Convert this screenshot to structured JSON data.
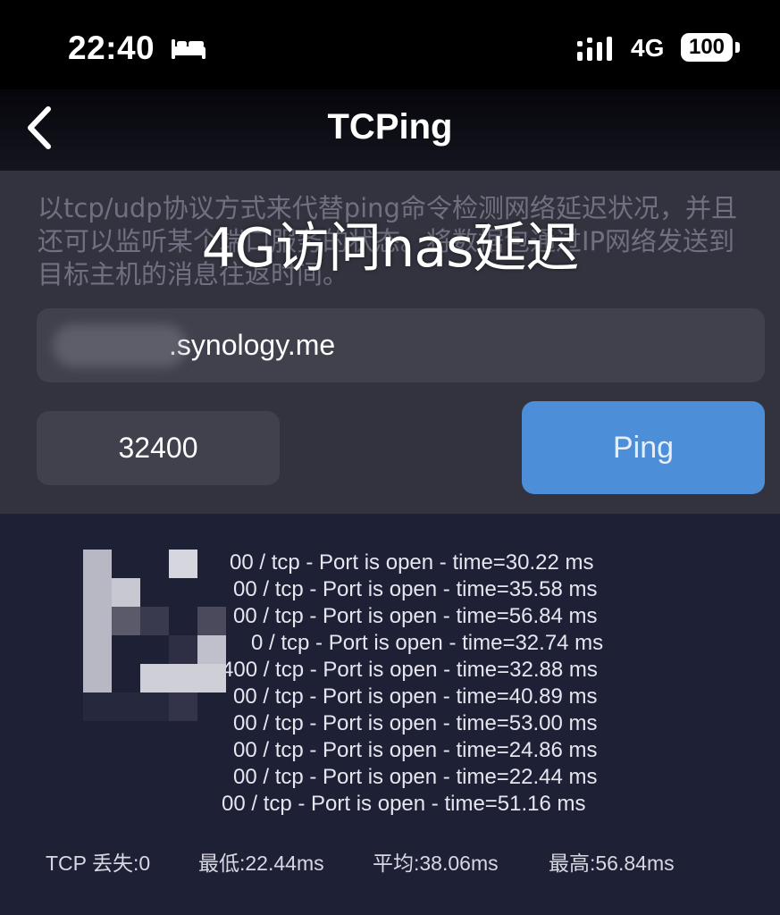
{
  "status_bar": {
    "time": "22:40",
    "focus_icon": "bed-icon",
    "signal_icon": "signal-icon",
    "network": "4G",
    "battery": "100"
  },
  "nav": {
    "back_icon": "chevron-left-icon",
    "title": "TCPing"
  },
  "description": "以tcp/udp协议方式来代替ping命令检测网络延迟状况，并且还可以监听某个端口服务的状态。将数据包通过IP网络发送到目标主机的消息往返时间。",
  "overlay_caption": "4G访问nas延迟",
  "host_input": {
    "value": ".synology.me"
  },
  "port_input": {
    "value": "32400"
  },
  "ping_button": {
    "label": "Ping",
    "color": "#4c8fd8"
  },
  "results": [
    "00 / tcp - Port is open - time=30.22 ms",
    "00 / tcp - Port is open - time=35.58 ms",
    "00 / tcp - Port is open - time=56.84 ms",
    "0 / tcp - Port is open - time=32.74 ms",
    "400 / tcp - Port is open - time=32.88 ms",
    "00 / tcp - Port is open - time=40.89 ms",
    "00 / tcp - Port is open - time=53.00 ms",
    "00 / tcp - Port is open - time=24.86 ms",
    "00 / tcp - Port is open - time=22.44 ms",
    "00 / tcp - Port is open - time=51.16 ms"
  ],
  "stats": {
    "loss": "TCP 丢失:0",
    "min": "最低:22.44ms",
    "avg": "平均:38.06ms",
    "max": "最高:56.84ms"
  }
}
